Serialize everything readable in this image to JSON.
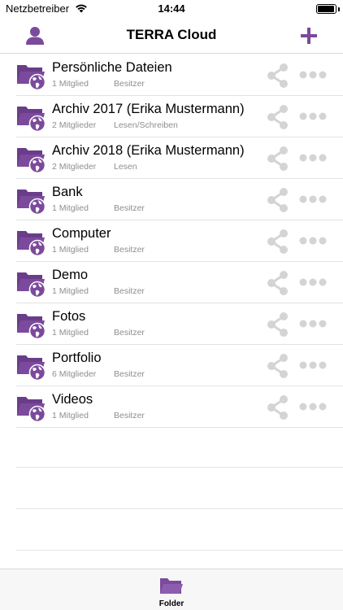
{
  "status_bar": {
    "carrier": "Netzbetreiber",
    "time": "14:44",
    "battery_level": 0.95
  },
  "nav": {
    "title": "TERRA Cloud",
    "left_icon": "user-icon",
    "right_icon": "plus-icon"
  },
  "colors": {
    "accent": "#7b4a9c",
    "secondary_text": "#8e8e93",
    "share_icon": "#d4d4d4",
    "more_icon": "#d4d4d4"
  },
  "folders": [
    {
      "name": "Persönliche Dateien",
      "members": "1 Mitglied",
      "role": "Besitzer"
    },
    {
      "name": "Archiv 2017 (Erika Mustermann)",
      "members": "2 Mitglieder",
      "role": "Lesen/Schreiben"
    },
    {
      "name": "Archiv 2018 (Erika Mustermann)",
      "members": "2 Mitglieder",
      "role": "Lesen"
    },
    {
      "name": "Bank",
      "members": "1 Mitglied",
      "role": "Besitzer"
    },
    {
      "name": "Computer",
      "members": "1 Mitglied",
      "role": "Besitzer"
    },
    {
      "name": "Demo",
      "members": "1 Mitglied",
      "role": "Besitzer"
    },
    {
      "name": "Fotos",
      "members": "1 Mitglied",
      "role": "Besitzer"
    },
    {
      "name": "Portfolio",
      "members": "6 Mitglieder",
      "role": "Besitzer"
    },
    {
      "name": "Videos",
      "members": "1 Mitglied",
      "role": "Besitzer"
    }
  ],
  "tab_bar": {
    "folder_label": "Folder",
    "folder_icon": "folder-icon"
  }
}
